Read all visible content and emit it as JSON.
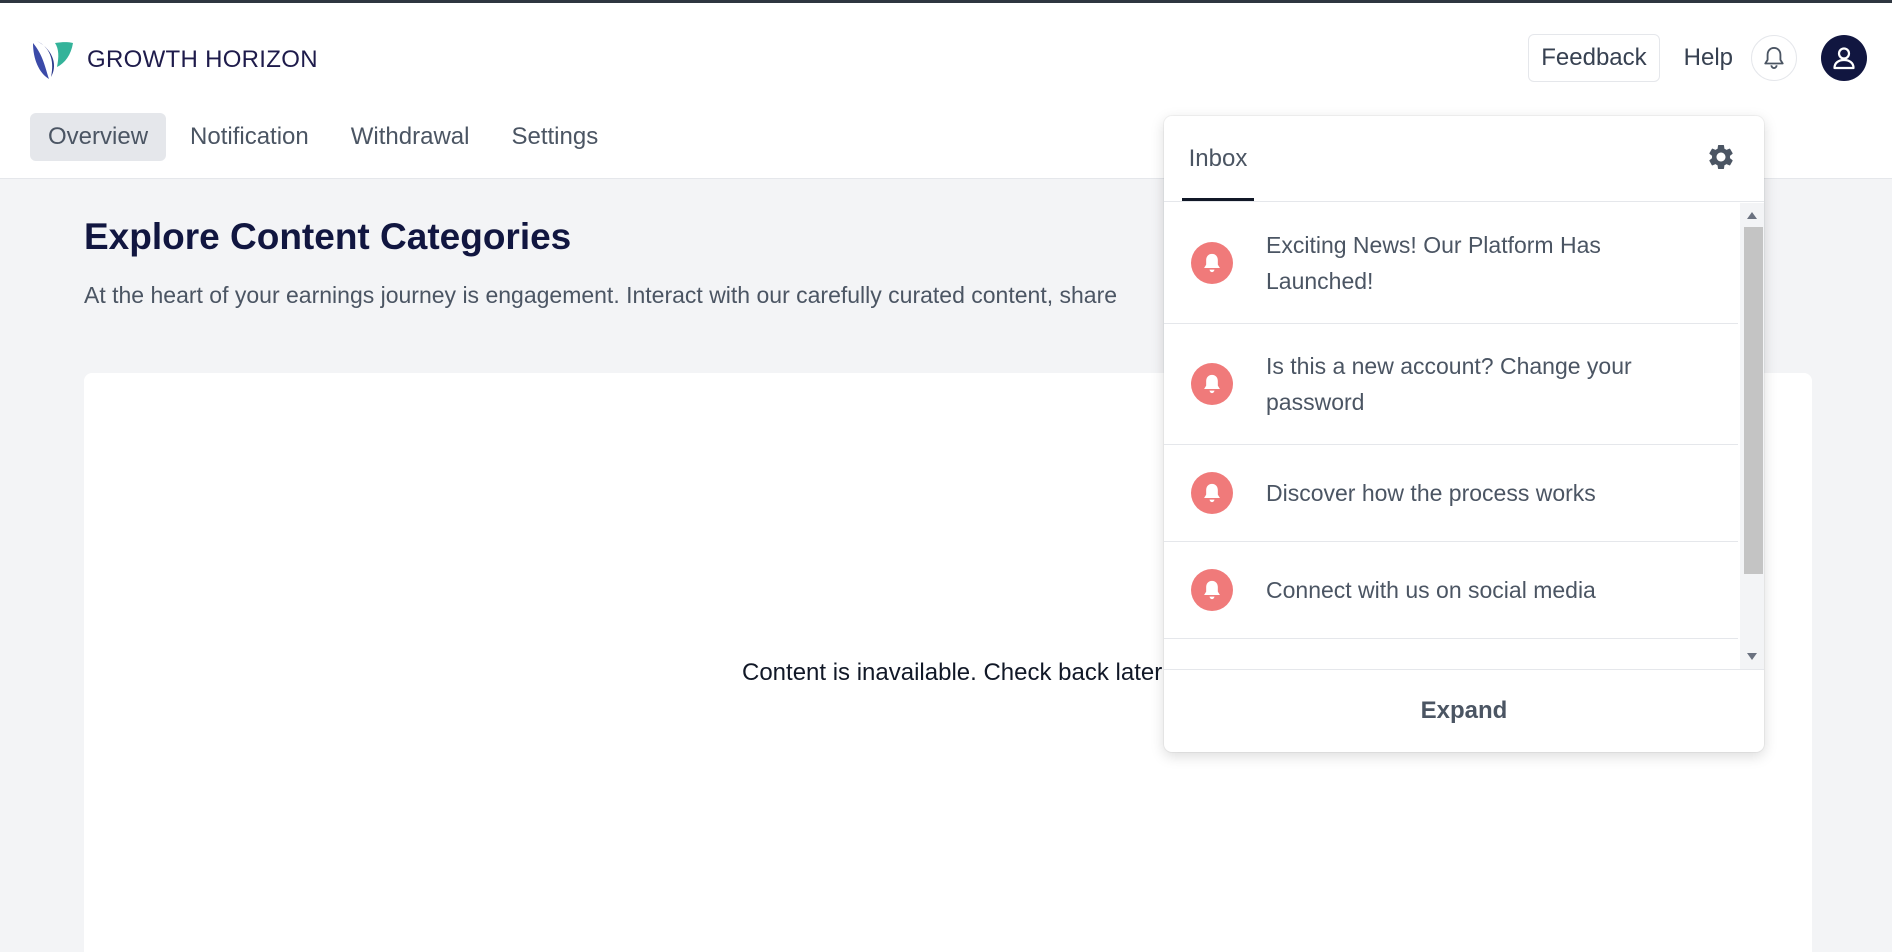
{
  "brand": {
    "name": "GROWTH HORIZON",
    "logo_icon": "leaf-logo-icon"
  },
  "header": {
    "feedback_label": "Feedback",
    "help_label": "Help",
    "bell_icon": "bell-icon",
    "avatar_icon": "user-icon"
  },
  "tabs": [
    {
      "label": "Overview",
      "active": true
    },
    {
      "label": "Notification",
      "active": false
    },
    {
      "label": "Withdrawal",
      "active": false
    },
    {
      "label": "Settings",
      "active": false
    }
  ],
  "main": {
    "title": "Explore Content Categories",
    "description": "At the heart of your earnings journey is engagement. Interact with our carefully curated content, share",
    "empty_message": "Content is inavailable. Check back later"
  },
  "inbox": {
    "tab_label": "Inbox",
    "settings_icon": "gear-icon",
    "notifications": [
      {
        "text": "Exciting News! Our Platform Has Launched!",
        "icon": "bell-icon"
      },
      {
        "text": "Is this a new account? Change your password",
        "icon": "bell-icon"
      },
      {
        "text": "Discover how the process works",
        "icon": "bell-icon"
      },
      {
        "text": "Connect with us on social media",
        "icon": "bell-icon"
      }
    ],
    "expand_label": "Expand"
  },
  "colors": {
    "brand_navy": "#111640",
    "notification_icon": "#f07a7a",
    "page_background": "#f3f4f6"
  }
}
